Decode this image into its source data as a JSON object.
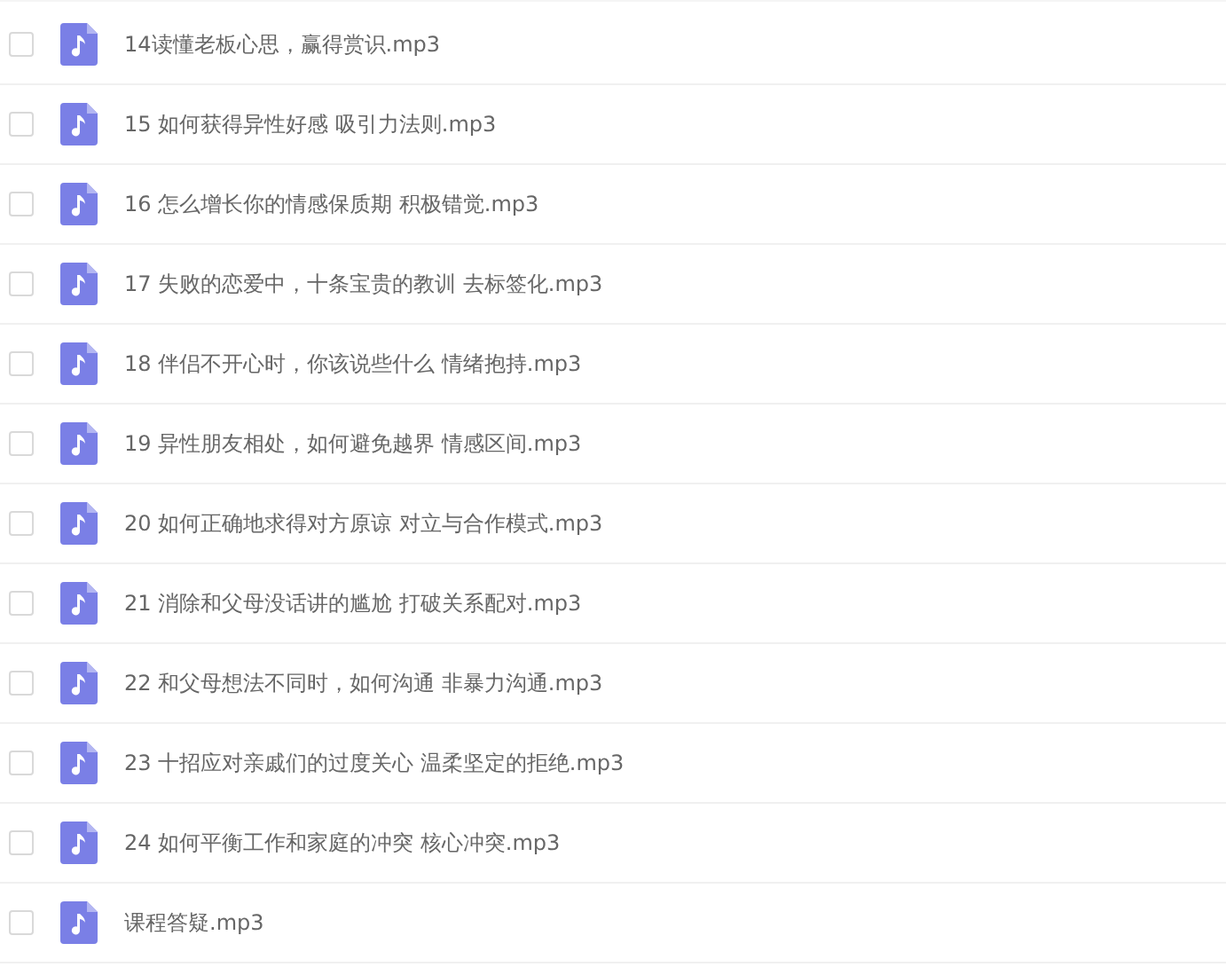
{
  "files": [
    {
      "name": "14读懂老板心思，赢得赏识.mp3",
      "checked": false
    },
    {
      "name": "15 如何获得异性好感 吸引力法则.mp3",
      "checked": false
    },
    {
      "name": "16 怎么增长你的情感保质期 积极错觉.mp3",
      "checked": false
    },
    {
      "name": "17 失败的恋爱中，十条宝贵的教训 去标签化.mp3",
      "checked": false
    },
    {
      "name": "18 伴侣不开心时，你该说些什么 情绪抱持.mp3",
      "checked": false
    },
    {
      "name": "19 异性朋友相处，如何避免越界 情感区间.mp3",
      "checked": false
    },
    {
      "name": "20 如何正确地求得对方原谅 对立与合作模式.mp3",
      "checked": false
    },
    {
      "name": "21 消除和父母没话讲的尴尬 打破关系配对.mp3",
      "checked": false
    },
    {
      "name": "22 和父母想法不同时，如何沟通 非暴力沟通.mp3",
      "checked": false
    },
    {
      "name": "23 十招应对亲戚们的过度关心 温柔坚定的拒绝.mp3",
      "checked": false
    },
    {
      "name": "24 如何平衡工作和家庭的冲突 核心冲突.mp3",
      "checked": false
    },
    {
      "name": "课程答疑.mp3",
      "checked": false
    }
  ]
}
